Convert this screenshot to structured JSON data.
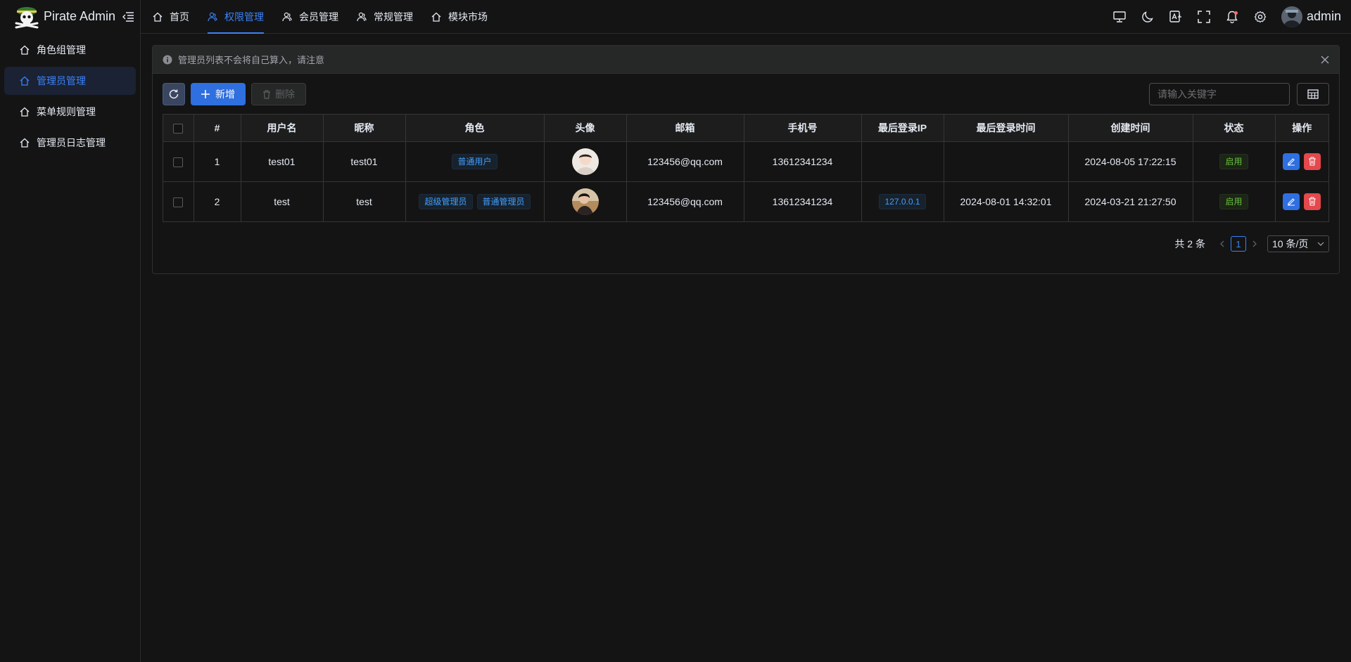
{
  "app": {
    "title": "Pirate Admin",
    "user": "admin"
  },
  "sidebar": {
    "items": [
      {
        "label": "角色组管理",
        "active": false
      },
      {
        "label": "管理员管理",
        "active": true
      },
      {
        "label": "菜单规则管理",
        "active": false
      },
      {
        "label": "管理员日志管理",
        "active": false
      }
    ]
  },
  "header": {
    "tabs": [
      {
        "label": "首页",
        "icon": "home-icon"
      },
      {
        "label": "权限管理",
        "icon": "users-icon",
        "active": true
      },
      {
        "label": "会员管理",
        "icon": "users-icon"
      },
      {
        "label": "常规管理",
        "icon": "users-icon"
      },
      {
        "label": "模块市场",
        "icon": "home-icon"
      }
    ],
    "actions": [
      "monitor-icon",
      "moon-icon",
      "translate-icon",
      "fullscreen-icon",
      "bell-icon",
      "gear-icon"
    ]
  },
  "alert": {
    "text": "管理员列表不会将自己算入，请注意"
  },
  "toolbar": {
    "add_label": "新增",
    "delete_label": "删除",
    "search_placeholder": "请输入关键字"
  },
  "table": {
    "columns": [
      "#",
      "用户名",
      "昵称",
      "角色",
      "头像",
      "邮箱",
      "手机号",
      "最后登录IP",
      "最后登录时间",
      "创建时间",
      "状态",
      "操作"
    ],
    "rows": [
      {
        "id": "1",
        "username": "test01",
        "nickname": "test01",
        "roles": [
          "普通用户"
        ],
        "email": "123456@qq.com",
        "phone": "13612341234",
        "last_ip": "",
        "last_login": "",
        "created": "2024-08-05 17:22:15",
        "status": "启用"
      },
      {
        "id": "2",
        "username": "test",
        "nickname": "test",
        "roles": [
          "超级管理员",
          "普通管理员"
        ],
        "email": "123456@qq.com",
        "phone": "13612341234",
        "last_ip": "127.0.0.1",
        "last_login": "2024-08-01 14:32:01",
        "created": "2024-03-21 21:27:50",
        "status": "启用"
      }
    ]
  },
  "pagination": {
    "total_text": "共 2 条",
    "current": "1",
    "page_size": "10 条/页"
  },
  "colors": {
    "accent": "#3b82f6",
    "danger": "#e5484d",
    "success": "#67c23a"
  }
}
